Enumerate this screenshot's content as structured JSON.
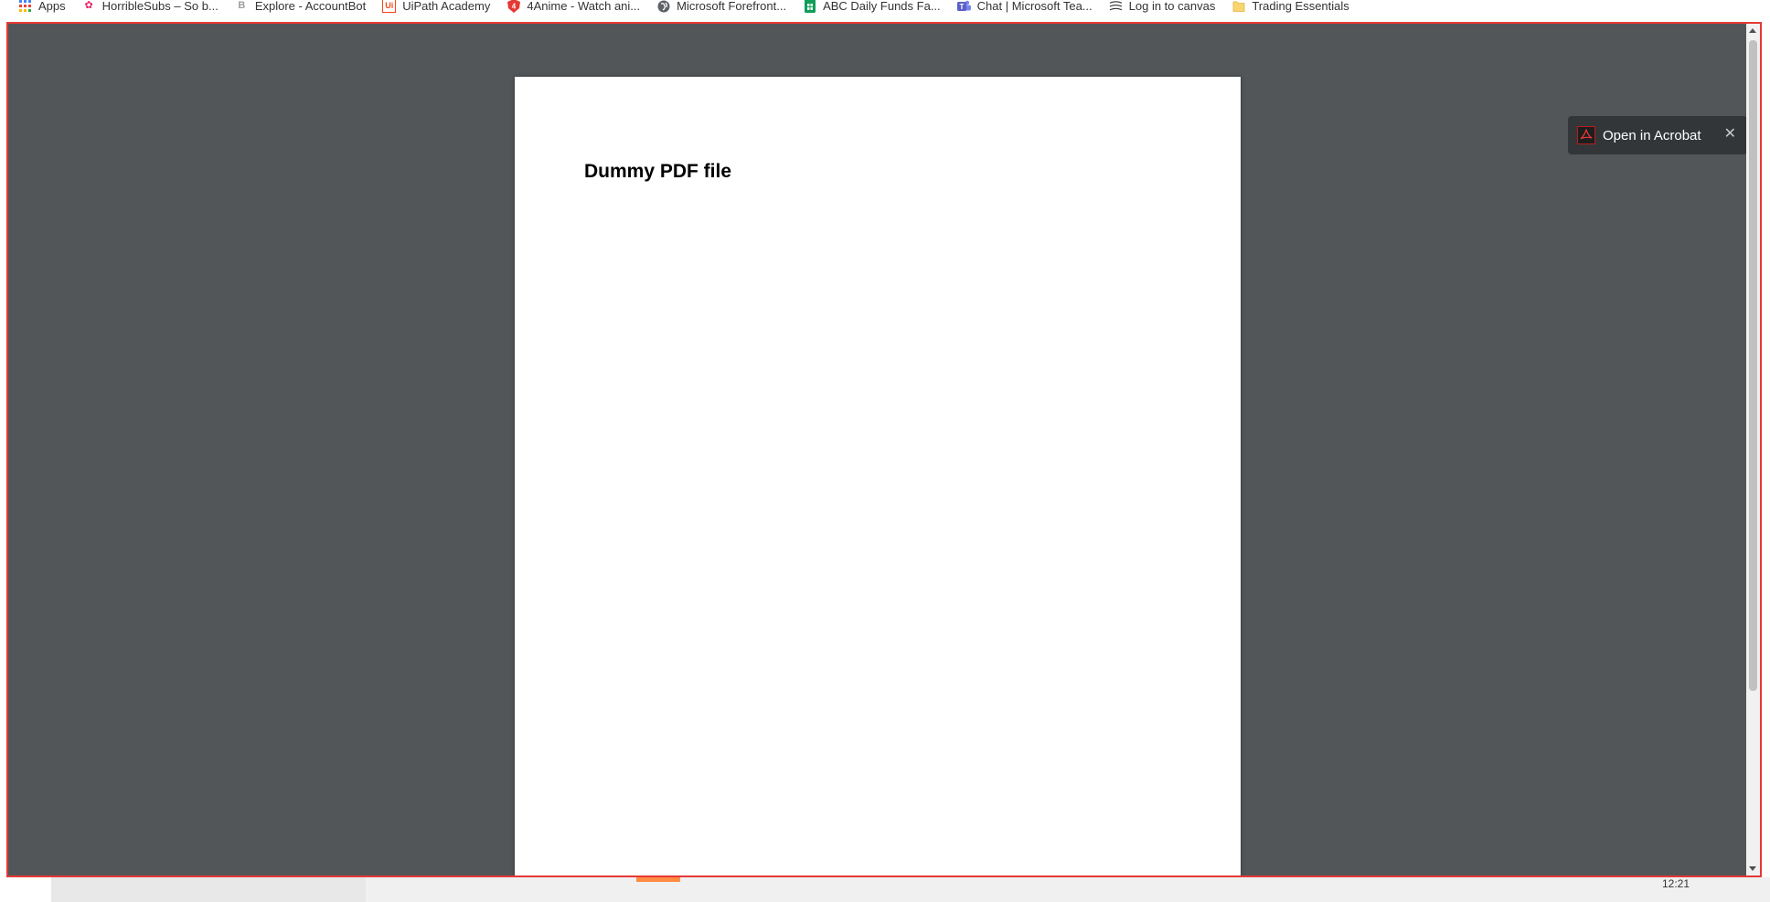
{
  "bookmarks": [
    {
      "label": "Apps",
      "icon": "apps-grid-icon",
      "color": "#4285f4"
    },
    {
      "label": "HorribleSubs – So b...",
      "icon": "horriblesubs-icon",
      "color": "#e91e63"
    },
    {
      "label": "Explore - AccountBot",
      "icon": "accountbot-icon",
      "color": "#9e9e9e"
    },
    {
      "label": "UiPath Academy",
      "icon": "uipath-icon",
      "color": "#fa4616"
    },
    {
      "label": "4Anime - Watch ani...",
      "icon": "4anime-icon",
      "color": "#e53935"
    },
    {
      "label": "Microsoft Forefront...",
      "icon": "globe-icon",
      "color": "#5f6368"
    },
    {
      "label": "ABC Daily Funds Fa...",
      "icon": "sheets-icon",
      "color": "#0f9d58"
    },
    {
      "label": "Chat | Microsoft Tea...",
      "icon": "teams-icon",
      "color": "#5b5fc7"
    },
    {
      "label": "Log in to canvas",
      "icon": "canvas-icon",
      "color": "#333333"
    },
    {
      "label": "Trading Essentials",
      "icon": "folder-icon",
      "color": "#f9d56e"
    }
  ],
  "viewer": {
    "title": "Dummy PDF file",
    "acrobat_label": "Open in Acrobat",
    "close_glyph": "✕",
    "background": "#525659",
    "page_background": "#ffffff"
  },
  "taskbar": {
    "time": "12:21"
  }
}
